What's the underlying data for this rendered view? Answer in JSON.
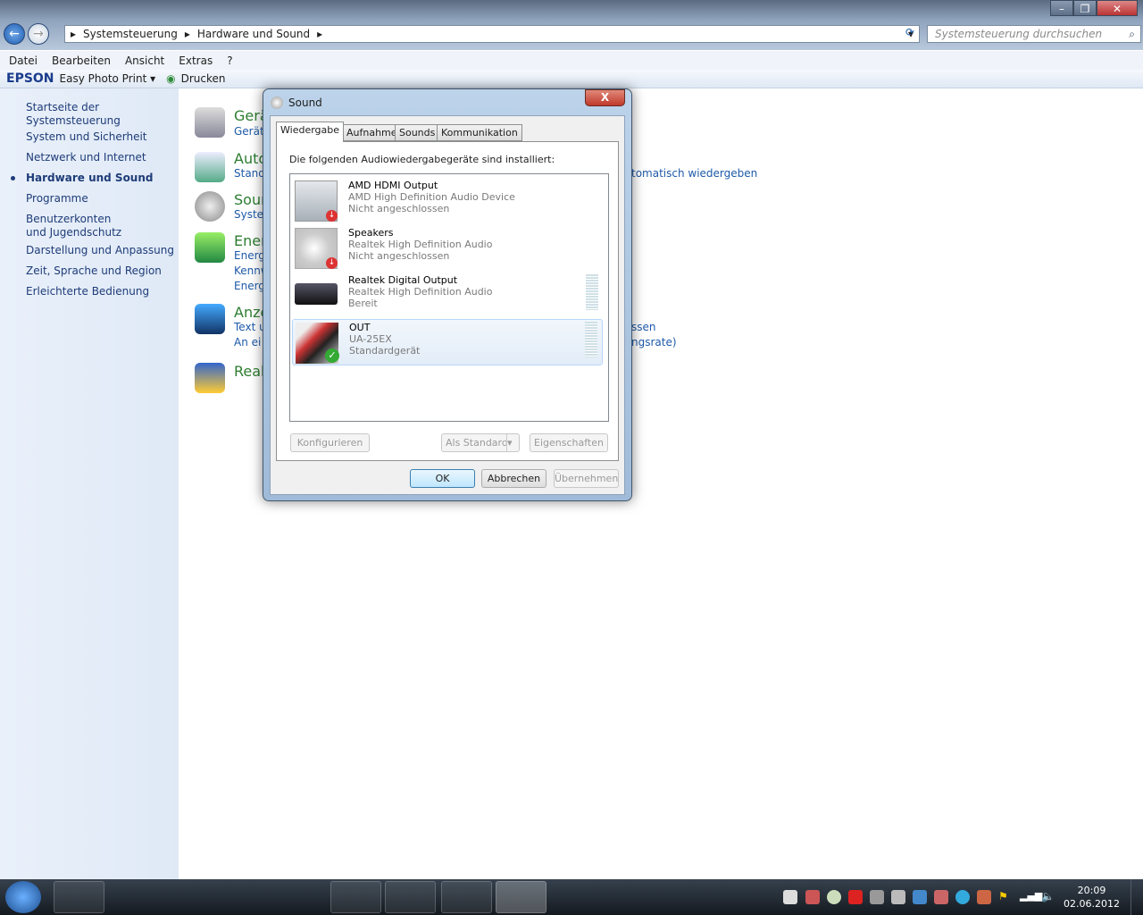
{
  "window": {
    "minimize": "–",
    "maximize": "❐",
    "close": "✕"
  },
  "address": {
    "crumbs": [
      "Systemsteuerung",
      "Hardware und Sound"
    ],
    "search_placeholder": "Systemsteuerung durchsuchen"
  },
  "menu": [
    "Datei",
    "Bearbeiten",
    "Ansicht",
    "Extras",
    "?"
  ],
  "commandbar": {
    "brand": "EPSON",
    "app": "Easy Photo Print",
    "print": "Drucken"
  },
  "sidebar": {
    "items": [
      "Startseite der Systemsteuerung",
      "System und Sicherheit",
      "Netzwerk und Internet",
      "Hardware und Sound",
      "Programme",
      "Benutzerkonten und Jugendschutz",
      "Darstellung und Anpassung",
      "Zeit, Sprache und Region",
      "Erleichterte Bedienung"
    ]
  },
  "categories": [
    {
      "title": "Gerä",
      "links": [
        "Gerät"
      ]
    },
    {
      "title": "Auto",
      "links": [
        "Stand"
      ]
    },
    {
      "title": "Sour",
      "links": [
        "Syster"
      ]
    },
    {
      "title": "Ener",
      "links": [
        "Energ",
        "Kennw",
        "Energ"
      ]
    },
    {
      "title": "Anze",
      "links": [
        "Text u",
        "An ei"
      ]
    },
    {
      "title": "Real",
      "links": []
    }
  ],
  "fragments": [
    "tomatisch wiedergeben",
    "ssen",
    "ngsrate)"
  ],
  "dialog": {
    "title": "Sound",
    "close": "X",
    "tabs": [
      "Wiedergabe",
      "Aufnahme",
      "Sounds",
      "Kommunikation"
    ],
    "intro": "Die folgenden Audiowiedergabegeräte sind installiert:",
    "devices": [
      {
        "name": "AMD HDMI Output",
        "driver": "AMD High Definition Audio Device",
        "status": "Nicht angeschlossen",
        "icon": "monitor-icon"
      },
      {
        "name": "Speakers",
        "driver": "Realtek High Definition Audio",
        "status": "Nicht angeschlossen",
        "icon": "speaker-icon"
      },
      {
        "name": "Realtek Digital Output",
        "driver": "Realtek High Definition Audio",
        "status": "Bereit",
        "icon": "receiver-icon"
      },
      {
        "name": "OUT",
        "driver": "UA-25EX",
        "status": "Standardgerät",
        "icon": "rca-cable-icon"
      }
    ],
    "buttons": {
      "configure": "Konfigurieren",
      "set_default": "Als Standard",
      "properties": "Eigenschaften",
      "ok": "OK",
      "cancel": "Abbrechen",
      "apply": "Übernehmen"
    }
  },
  "clock": {
    "time": "20:09",
    "date": "02.06.2012"
  }
}
